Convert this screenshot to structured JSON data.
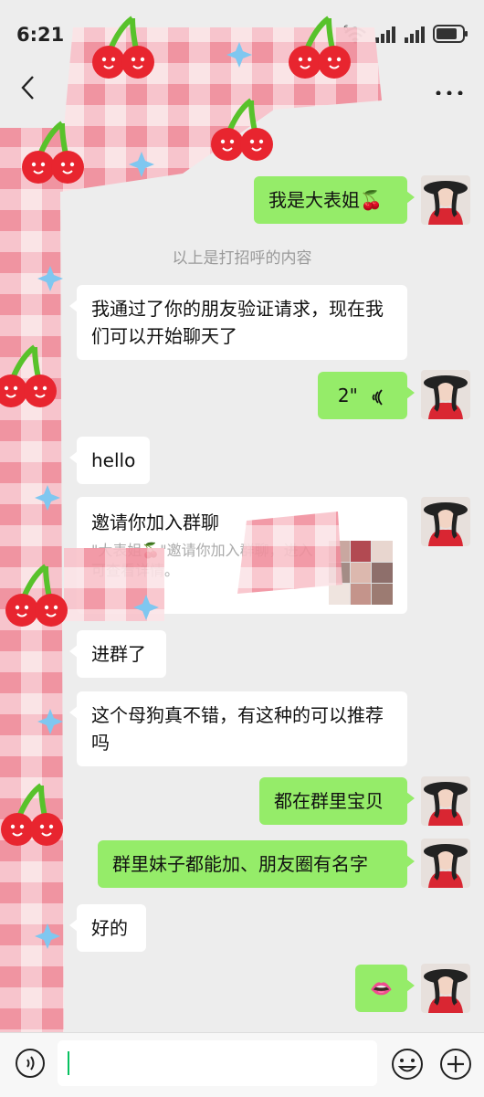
{
  "status": {
    "time": "6:21",
    "network_label": "6"
  },
  "chat": {
    "system_note": "以上是打招呼的内容",
    "messages": [
      {
        "side": "out",
        "text": "我是大表姐🍒"
      },
      {
        "side": "in",
        "text": "我通过了你的朋友验证请求，现在我们可以开始聊天了"
      },
      {
        "side": "out",
        "voice_duration": "2\""
      },
      {
        "side": "in",
        "text": "hello"
      },
      {
        "side": "in",
        "type": "group_invite",
        "title": "邀请你加入群聊",
        "desc": "\"大表姐🍒\"邀请你加入群聊，进入可查看详情。"
      },
      {
        "side": "in",
        "text": "进群了"
      },
      {
        "side": "in",
        "text": "这个母狗真不错，有这种的可以推荐吗"
      },
      {
        "side": "out",
        "text": "都在群里宝贝"
      },
      {
        "side": "out",
        "text": "群里妹子都能加、朋友圈有名字"
      },
      {
        "side": "in",
        "text": "好的"
      },
      {
        "side": "out",
        "text": "👄"
      }
    ]
  },
  "colors": {
    "bubble_out": "#95ec69",
    "bubble_in": "#ffffff",
    "background": "#ededed"
  },
  "icons": [
    "back-icon",
    "more-icon",
    "voice-icon",
    "emoji-icon",
    "plus-icon"
  ]
}
